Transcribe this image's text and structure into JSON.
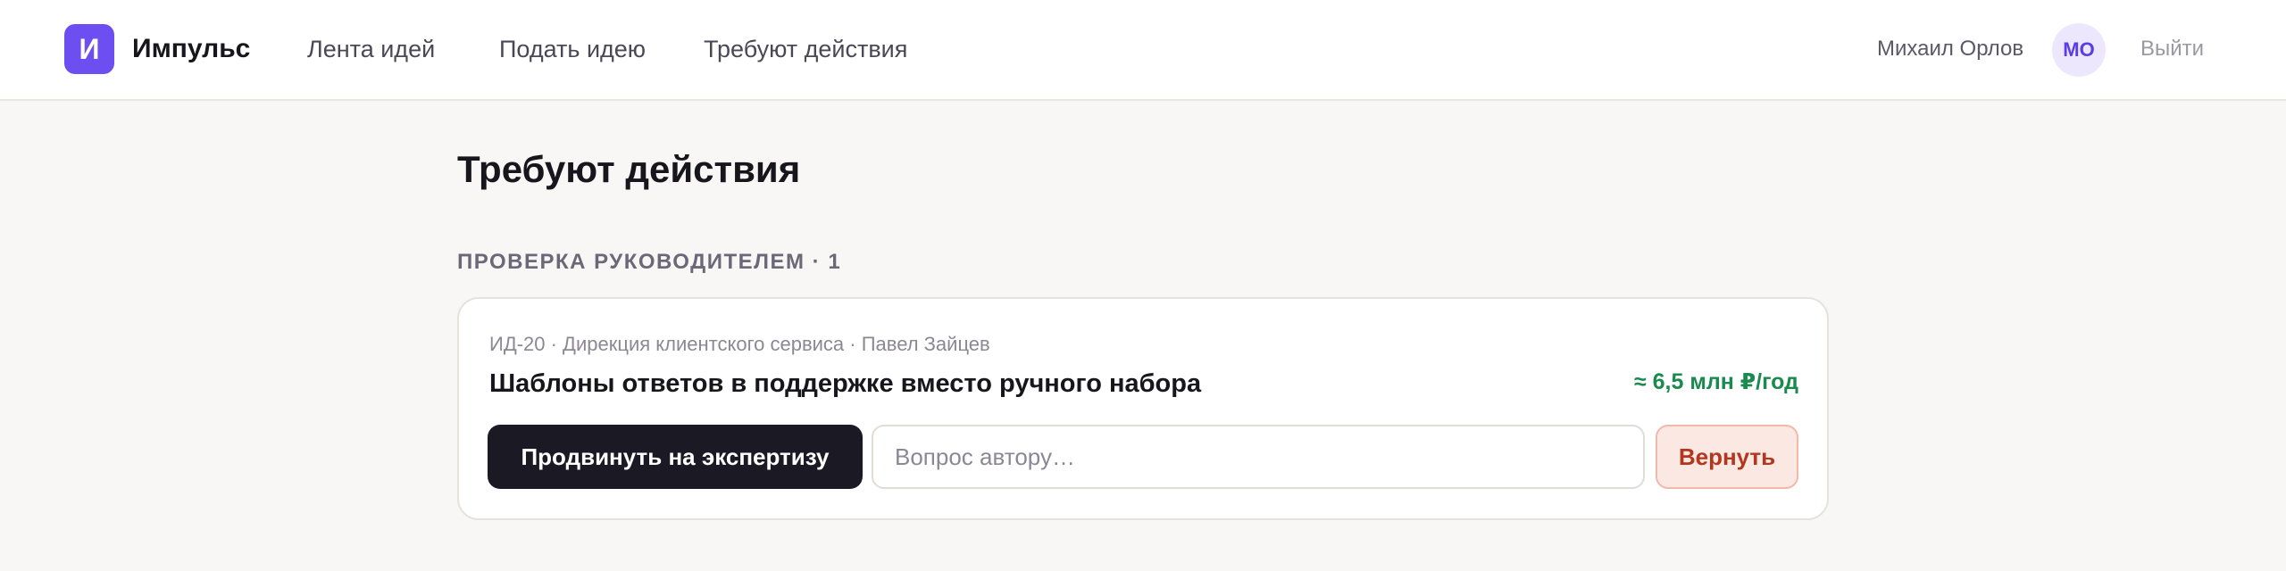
{
  "app": {
    "logo_letter": "И",
    "name": "Импульс",
    "accent_color": "#6d4ff1"
  },
  "nav": {
    "items": [
      {
        "label": "Лента идей"
      },
      {
        "label": "Подать идею"
      },
      {
        "label": "Требуют действия"
      }
    ]
  },
  "user": {
    "name": "Михаил Орлов",
    "initials": "МО",
    "logout_label": "Выйти"
  },
  "page": {
    "title": "Требуют действия"
  },
  "section": {
    "label": "ПРОВЕРКА РУКОВОДИТЕЛЕМ · 1"
  },
  "card": {
    "meta": "ИД-20 · Дирекция клиентского сервиса · Павел Зайцев",
    "title": "Шаблоны ответов в поддержке вместо ручного набора",
    "effect": "≈ 6,5 млн ₽/год",
    "effect_color": "#1b8a4e",
    "promote_label": "Продвинуть на экспертизу",
    "question_placeholder": "Вопрос автору…",
    "return_label": "Вернуть",
    "return_color": "#b3361f"
  }
}
